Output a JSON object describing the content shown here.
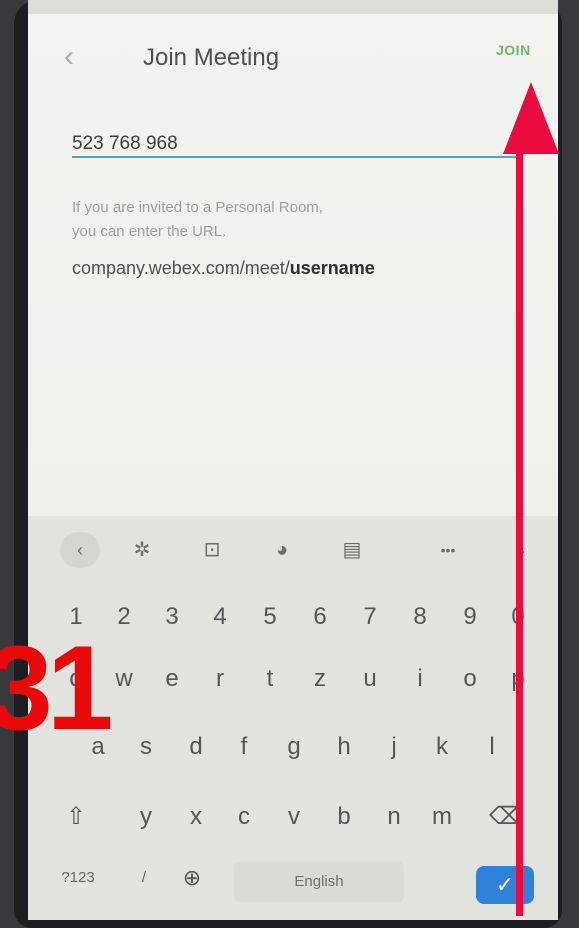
{
  "header": {
    "back_icon": "chevron-left-icon",
    "title": "Join Meeting",
    "join_label": "JOIN"
  },
  "meeting_input": {
    "value": "523 768 968"
  },
  "hint": {
    "line1": "If you are invited to a Personal Room,",
    "line2": "you can enter the URL.",
    "url_prefix": "company.webex.com/meet/",
    "url_user": "username"
  },
  "keyboard": {
    "toolbar_icons": [
      "chevron-left-icon",
      "gear-icon",
      "translate-icon",
      "palette-icon",
      "clipboard-icon",
      "more-icon",
      "chevron-down-icon"
    ],
    "toolbar": {
      "back": "‹",
      "settings": "✲",
      "translate": "⊡",
      "theme": "◕",
      "clipboard": "▤",
      "more": "•••",
      "hide": "⌄"
    },
    "numbers": [
      "1",
      "2",
      "3",
      "4",
      "5",
      "6",
      "7",
      "8",
      "9",
      "0"
    ],
    "row1": [
      "q",
      "w",
      "e",
      "r",
      "t",
      "z",
      "u",
      "i",
      "o",
      "p"
    ],
    "row2": [
      "a",
      "s",
      "d",
      "f",
      "g",
      "h",
      "j",
      "k",
      "l"
    ],
    "row3": [
      "y",
      "x",
      "c",
      "v",
      "b",
      "n",
      "m"
    ],
    "shift": "⇧",
    "backspace": "⌫",
    "symbols_label": "?123",
    "slash_label": "/",
    "globe": "⊕",
    "space_label": "English",
    "enter": "✓"
  },
  "annotation": {
    "number": "31",
    "arrow_color": "#ea0c3e"
  },
  "colors": {
    "accent_join": "#74b76a",
    "input_underline": "#5b9fb4",
    "enter_key": "#2f82d8"
  }
}
